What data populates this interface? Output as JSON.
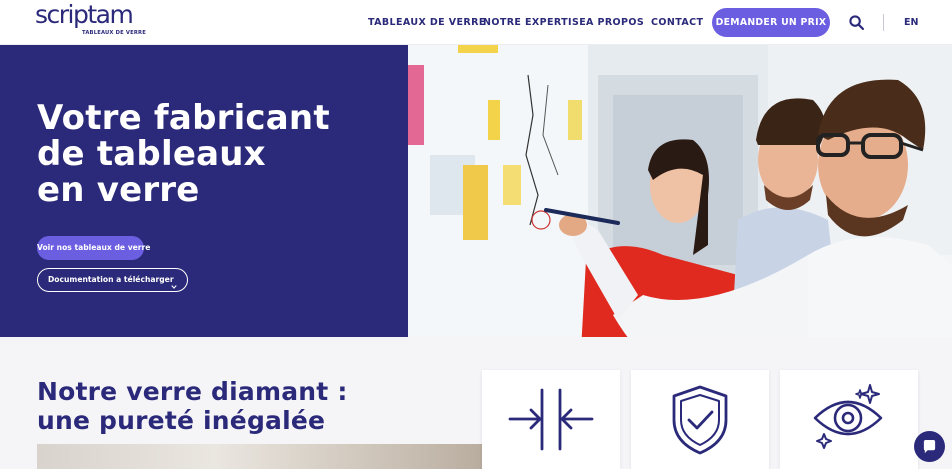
{
  "brand": {
    "name": "scriptam",
    "tagline": "TABLEAUX DE VERRE"
  },
  "nav": {
    "items": [
      "TABLEAUX DE VERRE",
      "NOTRE EXPERTISE",
      "A PROPOS",
      "CONTACT"
    ],
    "cta": "DEMANDER UN PRIX",
    "language": "EN"
  },
  "hero": {
    "title_lines": [
      "Votre fabricant",
      "de tableaux",
      "en verre"
    ],
    "primary_button": "Voir nos tableaux de verre",
    "secondary_button": "Documentation a télécharger"
  },
  "section": {
    "title_lines": [
      "Notre verre diamant :",
      "une pureté inégalée"
    ]
  },
  "features": {
    "icons": [
      "thin-profile-icon",
      "shield-check-icon",
      "eye-sparkle-icon"
    ]
  },
  "colors": {
    "primary": "#2b2a7a",
    "accent": "#6b5ee0",
    "background": "#ffffff",
    "section_bg": "#f5f5f8"
  }
}
